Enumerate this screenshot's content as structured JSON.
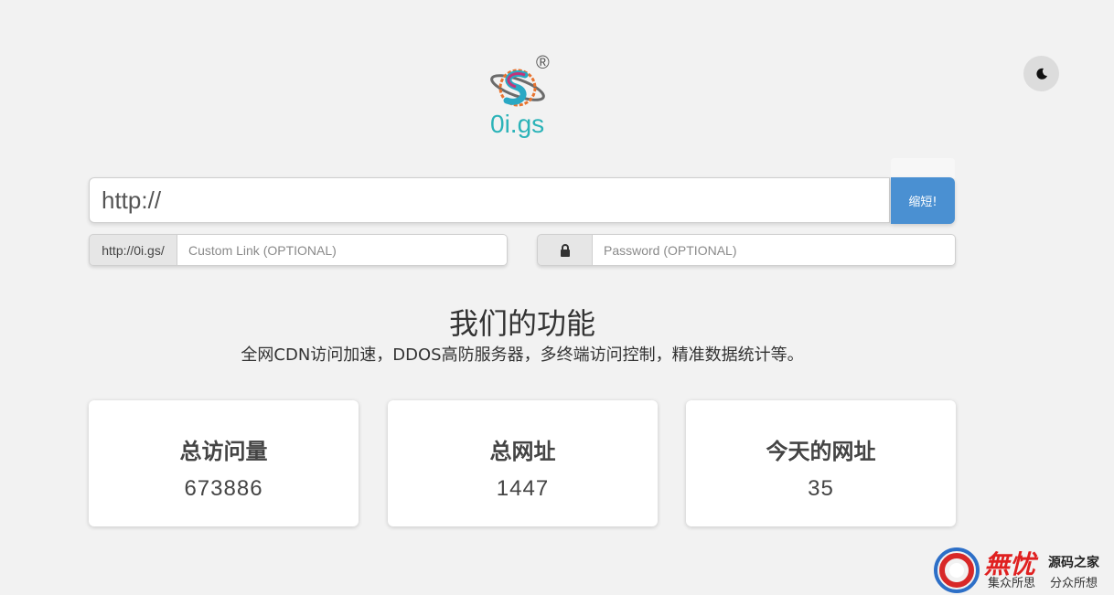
{
  "brand": {
    "logo_text": "0i.gs",
    "registered_mark": "®"
  },
  "theme_toggle": {
    "icon": "moon-icon"
  },
  "shortener": {
    "url_value": "http://",
    "shorten_label": "缩短!",
    "custom_prefix": "http://0i.gs/",
    "custom_placeholder": "Custom Link (OPTIONAL)",
    "password_icon": "lock-icon",
    "password_placeholder": "Password (OPTIONAL)"
  },
  "features": {
    "title": "我们的功能",
    "description": "全网CDN访问加速，DDOS高防服务器，多终端访问控制，精准数据统计等。"
  },
  "stats": [
    {
      "title": "总访问量",
      "value": "673886"
    },
    {
      "title": "总网址",
      "value": "1447"
    },
    {
      "title": "今天的网址",
      "value": "35"
    }
  ],
  "watermark": {
    "brand": "無忧",
    "name": "源码之家",
    "slogan_1": "集众所思",
    "slogan_2": "分众所想"
  },
  "colors": {
    "accent": "#4a90d2",
    "logo_teal": "#2bb3b8",
    "background": "#f2f2f2"
  }
}
